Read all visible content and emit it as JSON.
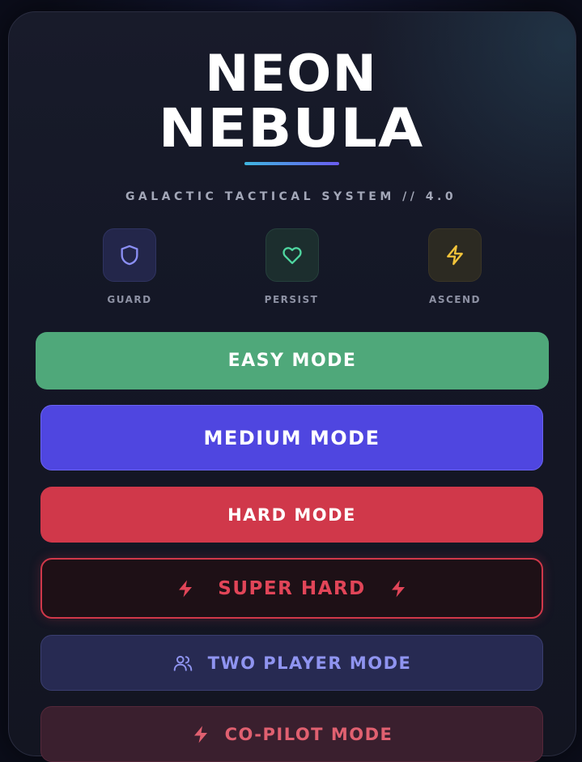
{
  "title": {
    "line1": "NEON",
    "line2": "NEBULA"
  },
  "subtitle": "GALACTIC TACTICAL SYSTEM // 4.0",
  "badges": [
    {
      "label": "GUARD",
      "icon": "shield-icon",
      "color": "#8b8ff5"
    },
    {
      "label": "PERSIST",
      "icon": "heart-icon",
      "color": "#4fd6a0"
    },
    {
      "label": "ASCEND",
      "icon": "lightning-icon",
      "color": "#f2c43a"
    }
  ],
  "modes": {
    "easy": {
      "label": "EASY MODE",
      "color": "#4fa87a"
    },
    "medium": {
      "label": "MEDIUM MODE",
      "color": "#4f46e0"
    },
    "hard": {
      "label": "HARD MODE",
      "color": "#d0384a"
    },
    "super_hard": {
      "label": "SUPER HARD",
      "color": "#e14558",
      "icon": "lightning-icon"
    },
    "two_player": {
      "label": "TWO PLAYER MODE",
      "color": "#8f94f0",
      "icon": "users-icon"
    },
    "co_pilot": {
      "label": "CO-PILOT MODE",
      "color": "#e06070",
      "icon": "lightning-icon"
    }
  }
}
